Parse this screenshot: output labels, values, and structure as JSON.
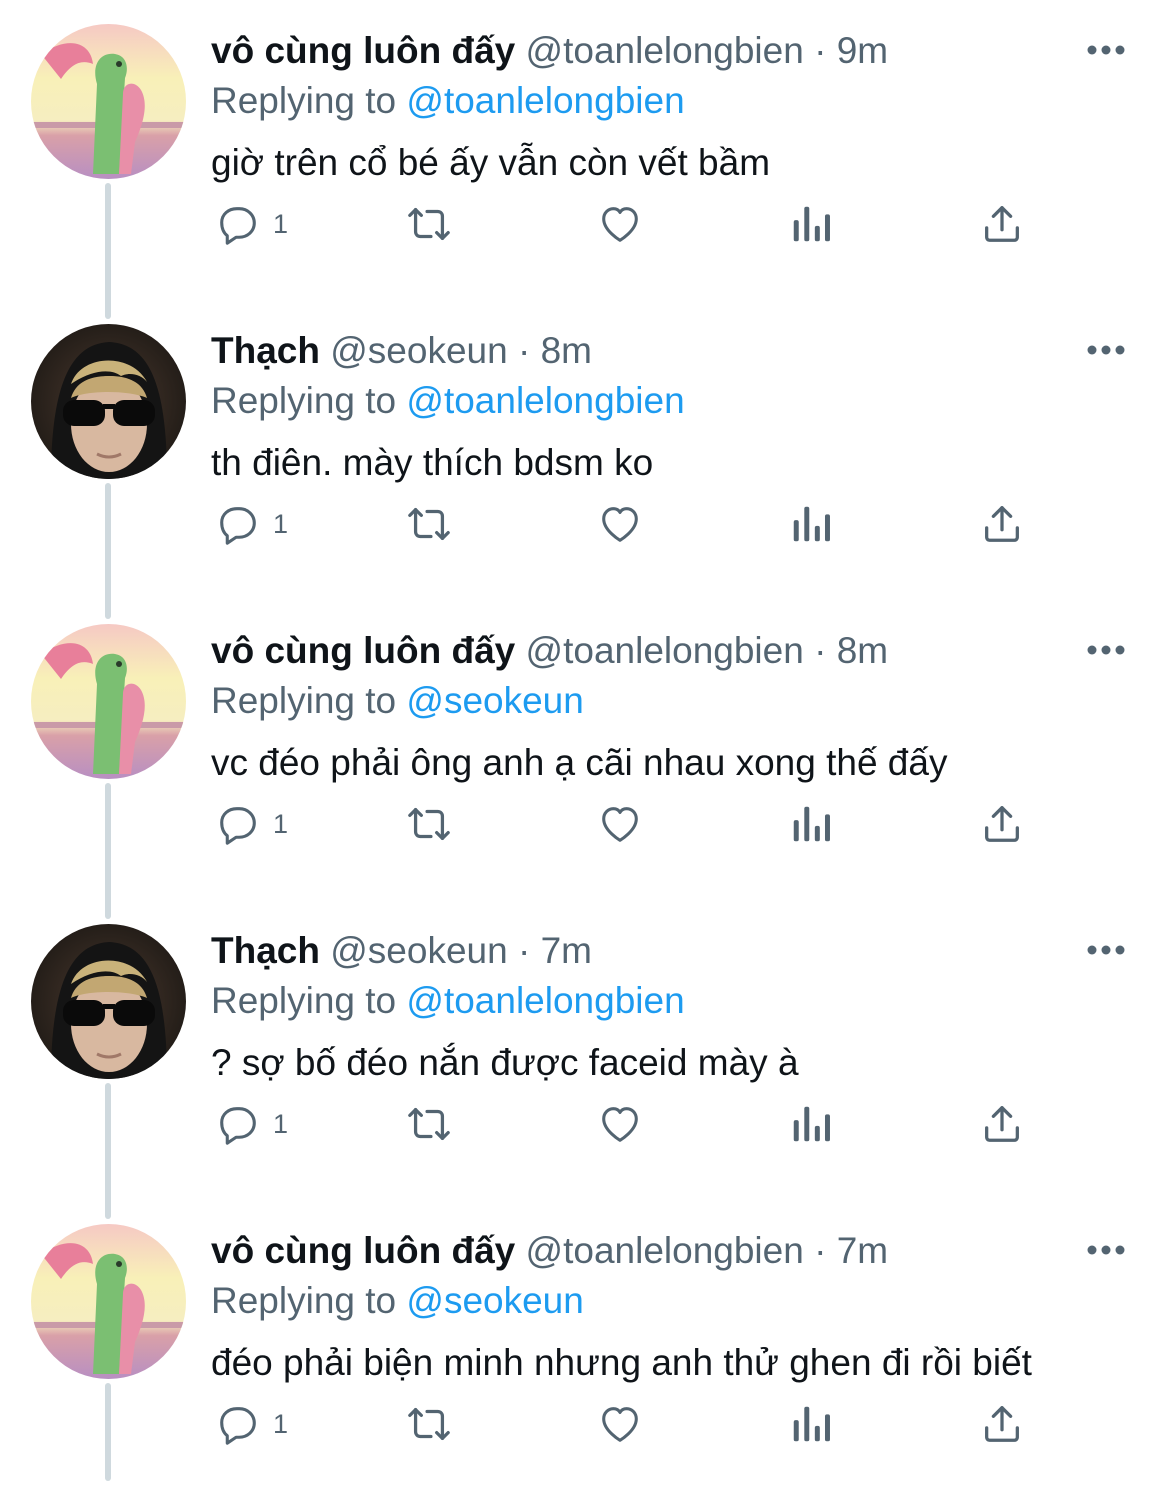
{
  "tweets": [
    {
      "display_name": "vô cùng luôn đấy",
      "handle": "@toanlelongbien",
      "time": "9m",
      "replying_prefix": "Replying to",
      "replying_to": "@toanlelongbien",
      "text": "giờ trên cổ bé ấy vẫn còn vết bầm",
      "reply_count": "1",
      "avatar": "dinosaur-cartoon-avatar"
    },
    {
      "display_name": "Thạch",
      "handle": "@seokeun",
      "time": "8m",
      "replying_prefix": "Replying to",
      "replying_to": "@toanlelongbien",
      "text": "th điên. mày thích bdsm ko",
      "reply_count": "1",
      "avatar": "person-sunglasses-avatar"
    },
    {
      "display_name": "vô cùng luôn đấy",
      "handle": "@toanlelongbien",
      "time": "8m",
      "replying_prefix": "Replying to",
      "replying_to": "@seokeun",
      "text": "vc đéo phải ông anh ạ cãi nhau xong thế đấy",
      "reply_count": "1",
      "avatar": "dinosaur-cartoon-avatar"
    },
    {
      "display_name": "Thạch",
      "handle": "@seokeun",
      "time": "7m",
      "replying_prefix": "Replying to",
      "replying_to": "@toanlelongbien",
      "text": "? sợ bố đéo nắn được faceid mày à",
      "reply_count": "1",
      "avatar": "person-sunglasses-avatar"
    },
    {
      "display_name": "vô cùng luôn đấy",
      "handle": "@toanlelongbien",
      "time": "7m",
      "replying_prefix": "Replying to",
      "replying_to": "@seokeun",
      "text": "đéo phải biện minh nhưng anh thử ghen đi rồi biết",
      "reply_count": "1",
      "avatar": "dinosaur-cartoon-avatar"
    }
  ],
  "separator": "·",
  "colors": {
    "link": "#1d9bf0",
    "secondary_text": "#536471",
    "primary_text": "#0f1419",
    "thread_line": "#cfd9de"
  },
  "icons": [
    "reply-icon",
    "retweet-icon",
    "like-icon",
    "views-icon",
    "share-icon",
    "more-icon"
  ]
}
